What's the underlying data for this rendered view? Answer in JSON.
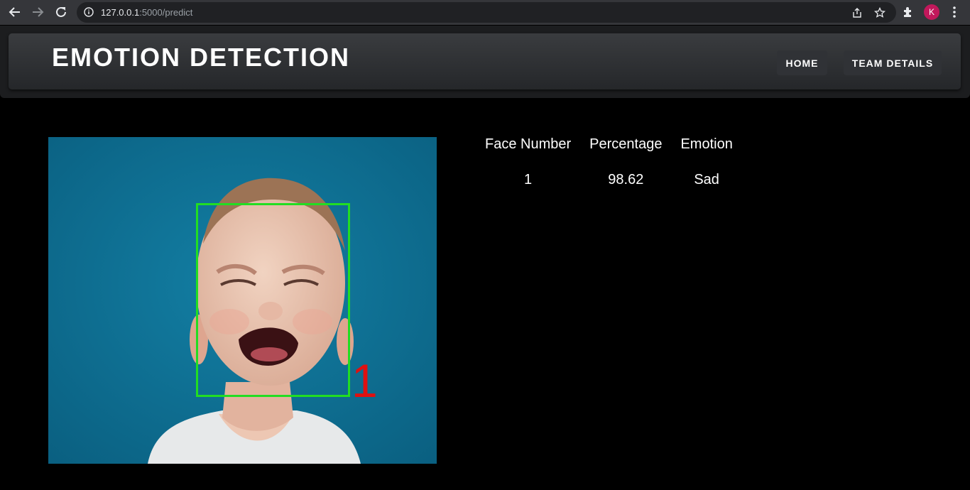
{
  "browser": {
    "url_host": "127.0.0.1",
    "url_rest": ":5000/predict",
    "profile_initial": "K",
    "profile_color": "#c2185b"
  },
  "site": {
    "title": "EMOTION DETECTION",
    "nav": {
      "home": "HOME",
      "team_details": "TEAM DETAILS"
    }
  },
  "detection": {
    "face_label": "1",
    "box_color": "#22dd22",
    "label_color": "#e01010"
  },
  "results": {
    "headers": {
      "face_number": "Face Number",
      "percentage": "Percentage",
      "emotion": "Emotion"
    },
    "rows": [
      {
        "face_number": "1",
        "percentage": "98.62",
        "emotion": "Sad"
      }
    ]
  }
}
